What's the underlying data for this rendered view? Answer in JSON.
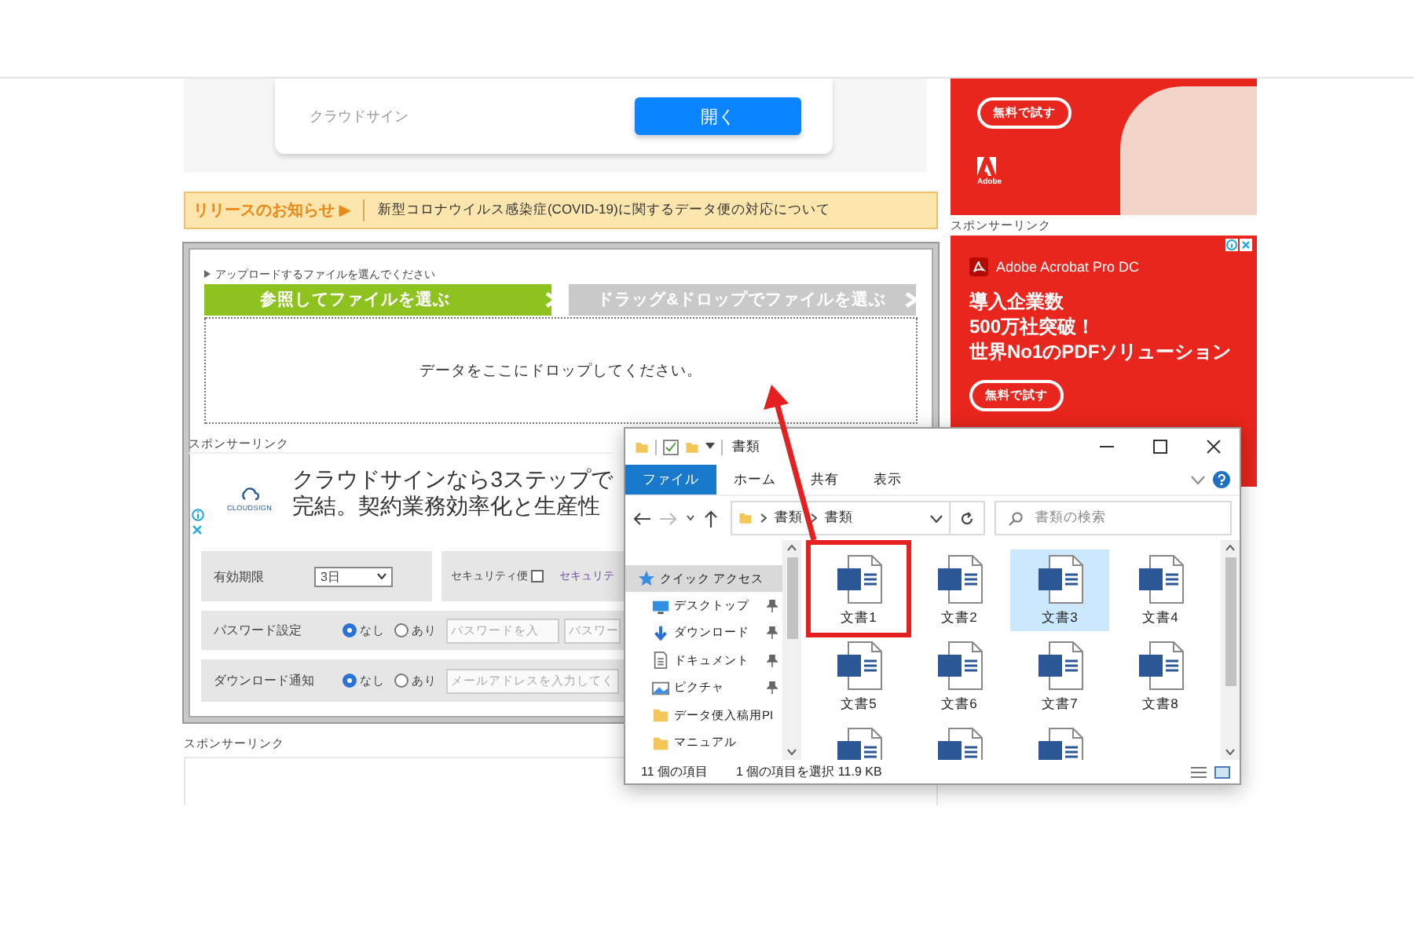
{
  "service_card": {
    "label": "クラウドサイン",
    "button": "開く"
  },
  "notice": {
    "heading": "リリースのお知らせ ▶",
    "link": "新型コロナウイルス感染症(COVID-19)に関するデータ便の対応について"
  },
  "upload": {
    "hint": "アップロードするファイルを選んでください",
    "tabs": [
      {
        "label": "参照してファイルを選ぶ",
        "selected": true
      },
      {
        "label": "ドラッグ&ドロップでファイルを選ぶ",
        "selected": false
      }
    ],
    "drop_text": "データをここにドロップしてください。",
    "sponsor_label": "スポンサーリンク",
    "ad": {
      "logo_text": "CLOUDSIGN",
      "headline": [
        "クラウドサインなら3ステップで",
        "完結。契約業務効率化と生産性"
      ]
    },
    "settings": {
      "expiry": {
        "label": "有効期限",
        "value": "3日"
      },
      "security": {
        "label": "セキュリティ便",
        "checked": false,
        "link": "セキュリテ"
      },
      "password": {
        "label": "パスワード設定",
        "options": [
          {
            "label": "なし",
            "selected": true
          },
          {
            "label": "あり",
            "selected": false
          }
        ],
        "fields": [
          {
            "placeholder": "パスワードを入"
          },
          {
            "placeholder": "パスワー"
          }
        ]
      },
      "notify": {
        "label": "ダウンロード通知",
        "options": [
          {
            "label": "なし",
            "selected": true
          },
          {
            "label": "あり",
            "selected": false
          }
        ],
        "fields": [
          {
            "placeholder": "メールアドレスを入力してく"
          }
        ]
      }
    }
  },
  "bottom_sponsor_label": "スポンサーリンク",
  "side_ad_top": {
    "button": "無料で試す",
    "logo_text": "Adobe"
  },
  "side_sponsor_label": "スポンサーリンク",
  "side_ad": {
    "brand": "Adobe Acrobat Pro DC",
    "headline": [
      "導入企業数",
      "500万社突破！",
      "世界No1のPDFソリューション"
    ],
    "button": "無料で試す"
  },
  "explorer": {
    "title": "書類",
    "ribbon_tabs": [
      {
        "label": "ファイル",
        "selected": true
      },
      {
        "label": "ホーム",
        "selected": false
      },
      {
        "label": "共有",
        "selected": false
      },
      {
        "label": "表示",
        "selected": false
      }
    ],
    "breadcrumb": [
      "書類",
      "書類"
    ],
    "search_placeholder": "書類の検索",
    "nav": [
      {
        "kind": "star",
        "label": "クイック アクセス",
        "selected": true,
        "pinned": false
      },
      {
        "kind": "desktop",
        "label": "デスクトップ",
        "selected": false,
        "pinned": true
      },
      {
        "kind": "download",
        "label": "ダウンロード",
        "selected": false,
        "pinned": true
      },
      {
        "kind": "document",
        "label": "ドキュメント",
        "selected": false,
        "pinned": true
      },
      {
        "kind": "picture",
        "label": "ピクチャ",
        "selected": false,
        "pinned": true
      },
      {
        "kind": "folder",
        "label": "データ便入稿用PI",
        "selected": false,
        "pinned": false
      },
      {
        "kind": "folder",
        "label": "マニュアル",
        "selected": false,
        "pinned": false
      }
    ],
    "files": [
      {
        "name": "文書1",
        "selected": false,
        "highlighted": true
      },
      {
        "name": "文書2",
        "selected": false,
        "highlighted": false
      },
      {
        "name": "文書3",
        "selected": true,
        "highlighted": false
      },
      {
        "name": "文書4",
        "selected": false,
        "highlighted": false
      },
      {
        "name": "文書5",
        "selected": false,
        "highlighted": false
      },
      {
        "name": "文書6",
        "selected": false,
        "highlighted": false
      },
      {
        "name": "文書7",
        "selected": false,
        "highlighted": false
      },
      {
        "name": "文書8",
        "selected": false,
        "highlighted": false
      },
      {
        "selected": false,
        "highlighted": false
      },
      {
        "selected": false,
        "highlighted": false
      },
      {
        "selected": false,
        "highlighted": false
      }
    ],
    "status": {
      "count": "11 個の項目",
      "selection": "1 個の項目を選択  11.9 KB"
    }
  }
}
